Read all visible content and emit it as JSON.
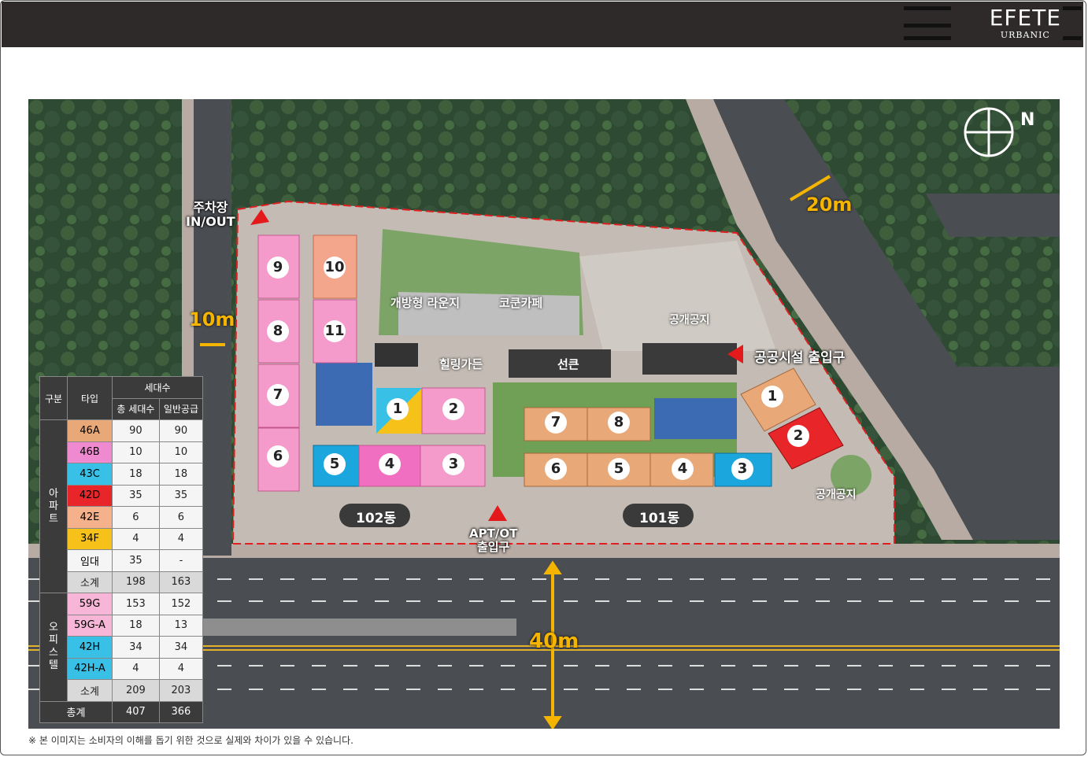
{
  "brand": {
    "name": "EFETE",
    "sub": "URBANIC"
  },
  "map": {
    "labels": {
      "parking": [
        "주차장",
        "IN/OUT"
      ],
      "road_10m": "10m",
      "road_20m": "20m",
      "road_40m": "40m",
      "lounge": "개방형 라운지",
      "cafe": "코쿤카페",
      "open_space_top": "공개공지",
      "healing_garden": "힐링가든",
      "sunken": "선큰",
      "public_entrance": "공공시설 출입구",
      "open_space_right": "공개공지",
      "bldg_102": "102동",
      "bldg_101": "101동",
      "apt_entrance": [
        "APT/OT",
        "출입구"
      ]
    },
    "units_102": [
      "9",
      "10",
      "8",
      "11",
      "7",
      "6",
      "1",
      "2",
      "5",
      "4",
      "3"
    ],
    "units_101": [
      "7",
      "8",
      "6",
      "5",
      "4",
      "3",
      "1",
      "2"
    ],
    "compass": "N"
  },
  "table": {
    "headers": {
      "group": "구분",
      "type": "타입",
      "households": "세대수",
      "total": "총 세대수",
      "general": "일반공급"
    },
    "apt_group": "아파트",
    "apt_rows": [
      {
        "type": "46A",
        "color": "#e8a877",
        "total": "90",
        "general": "90"
      },
      {
        "type": "46B",
        "color": "#f08ad0",
        "total": "10",
        "general": "10"
      },
      {
        "type": "43C",
        "color": "#38c0e6",
        "total": "18",
        "general": "18"
      },
      {
        "type": "42D",
        "color": "#e8262a",
        "total": "35",
        "general": "35"
      },
      {
        "type": "42E",
        "color": "#f5b08c",
        "total": "6",
        "general": "6"
      },
      {
        "type": "34F",
        "color": "#f6c21a",
        "total": "4",
        "general": "4"
      },
      {
        "type": "임대",
        "color": "#f5f5f5",
        "total": "35",
        "general": "-"
      }
    ],
    "apt_subtotal": {
      "label": "소계",
      "total": "198",
      "general": "163"
    },
    "off_group": "오피스텔",
    "off_rows": [
      {
        "type": "59G",
        "color": "#f7b6d8",
        "total": "153",
        "general": "152"
      },
      {
        "type": "59G-A",
        "color": "#f7b6d8",
        "total": "18",
        "general": "13"
      },
      {
        "type": "42H",
        "color": "#38c0e6",
        "total": "34",
        "general": "34"
      },
      {
        "type": "42H-A",
        "color": "#38c0e6",
        "total": "4",
        "general": "4"
      }
    ],
    "off_subtotal": {
      "label": "소계",
      "total": "209",
      "general": "203"
    },
    "grand_total": {
      "label": "총계",
      "total": "407",
      "general": "366"
    }
  },
  "footnote": "※ 본 이미지는 소비자의 이해를 돕기 위한 것으로 실제와 차이가 있을 수 있습니다."
}
